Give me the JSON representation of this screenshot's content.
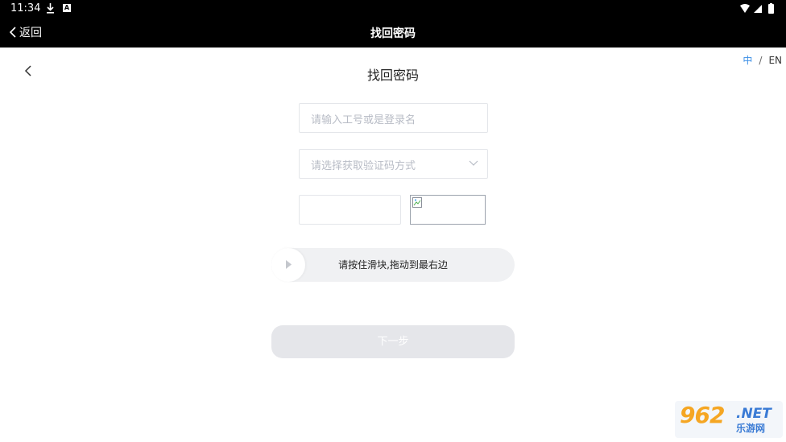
{
  "status_bar": {
    "time": "11:34",
    "a_badge": "A"
  },
  "app_bar": {
    "back_label": "返回",
    "title": "找回密码"
  },
  "page": {
    "title": "找回密码"
  },
  "language": {
    "zh": "中",
    "separator": "/",
    "en": "EN",
    "active": "中"
  },
  "form": {
    "username_placeholder": "请输入工号或是登录名",
    "method_placeholder": "请选择获取验证码方式",
    "code_value": ""
  },
  "slider": {
    "label": "请按住滑块,拖动到最右边",
    "progress": 0
  },
  "next_button": {
    "label": "下一步"
  },
  "watermark": {
    "number": "962",
    "net": ".NET",
    "cn": "乐游网"
  },
  "colors": {
    "accent": "#3a8ee6",
    "disabled_button": "#e5e6ea",
    "bar_bg": "#000000"
  }
}
